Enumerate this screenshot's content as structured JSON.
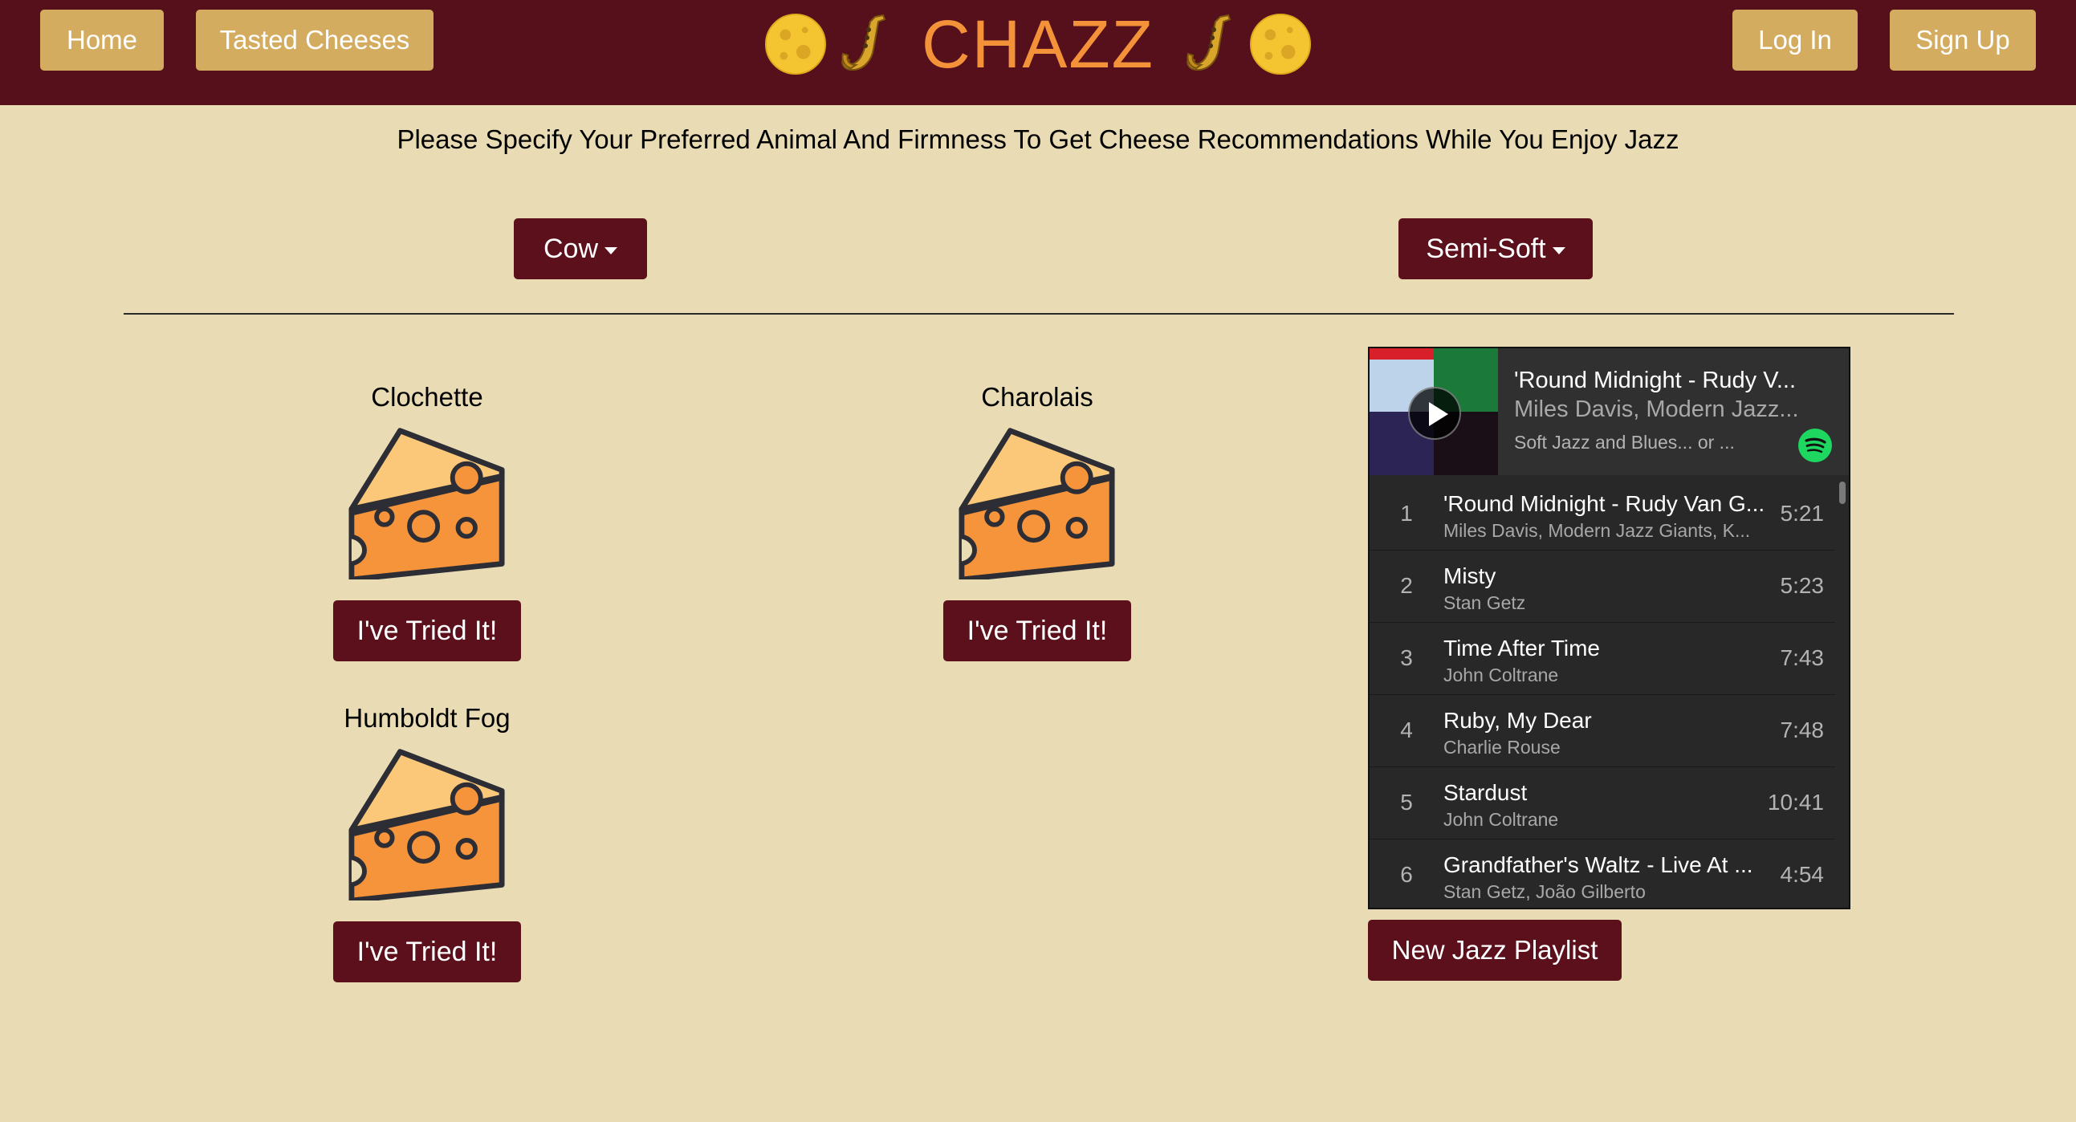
{
  "nav": {
    "home_label": "Home",
    "tasted_label": "Tasted Cheeses",
    "brand": "CHAZZ",
    "login_label": "Log In",
    "signup_label": "Sign Up"
  },
  "instructions": "Please Specify Your Preferred Animal And Firmness To Get Cheese Recommendations While You Enjoy Jazz",
  "filters": {
    "animal": "Cow",
    "firmness": "Semi-Soft"
  },
  "cheeses": [
    {
      "name": "Clochette",
      "button": "I've Tried It!"
    },
    {
      "name": "Charolais",
      "button": "I've Tried It!"
    },
    {
      "name": "Humboldt Fog",
      "button": "I've Tried It!"
    }
  ],
  "player": {
    "now_playing_title": "'Round Midnight - Rudy V...",
    "now_playing_artist": "Miles Davis, Modern Jazz...",
    "playlist_name": "Soft Jazz and Blues... or ...",
    "tracks": [
      {
        "num": "1",
        "title": "'Round Midnight - Rudy Van G...",
        "artist": "Miles Davis, Modern Jazz Giants, K...",
        "duration": "5:21"
      },
      {
        "num": "2",
        "title": "Misty",
        "artist": "Stan Getz",
        "duration": "5:23"
      },
      {
        "num": "3",
        "title": "Time After Time",
        "artist": "John Coltrane",
        "duration": "7:43"
      },
      {
        "num": "4",
        "title": "Ruby, My Dear",
        "artist": "Charlie Rouse",
        "duration": "7:48"
      },
      {
        "num": "5",
        "title": "Stardust",
        "artist": "John Coltrane",
        "duration": "10:41"
      },
      {
        "num": "6",
        "title": "Grandfather's Waltz - Live At ...",
        "artist": "Stan Getz, João Gilberto",
        "duration": "4:54"
      }
    ]
  },
  "new_playlist_label": "New Jazz Playlist",
  "colors": {
    "navbar": "#55101b",
    "nav_button": "#d4ac5f",
    "brand_text": "#f4923a",
    "page_bg": "#e9dcb5",
    "primary_button": "#5c101c",
    "spotify_green": "#1ed760"
  },
  "icons": [
    "full-moon-icon",
    "saxophone-icon",
    "cheese-wedge-icon",
    "play-icon",
    "spotify-logo-icon",
    "caret-down-icon"
  ]
}
